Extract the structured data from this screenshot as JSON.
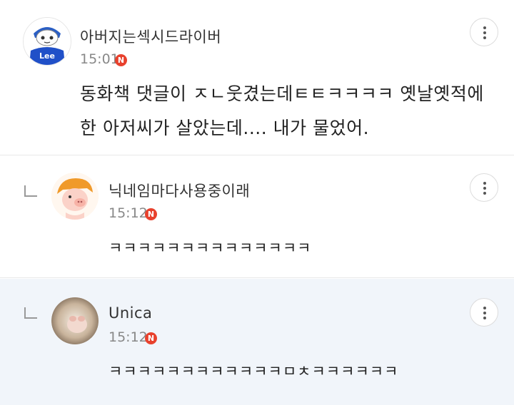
{
  "comments": [
    {
      "author": "아버지는섹시드라이버",
      "time": "15:01",
      "badge": "N",
      "text_line1": "동화책 댓글이 ㅈㄴ웃겼는데ㅌㅌㅋㅋㅋㅋ 옛날옛적에",
      "text_line2": "한 아저씨가 살았는데.... 내가 물었어.",
      "avatar_text": "Lee"
    },
    {
      "author": "닉네임마다사용중이래",
      "time": "15:12",
      "badge": "N",
      "text": "ㅋㅋㅋㅋㅋㅋㅋㅋㅋㅋㅋㅋㅋㅋ"
    },
    {
      "author": "Unica",
      "time": "15:12",
      "badge": "N",
      "text": "ㅋㅋㅋㅋㅋㅋㅋㅋㅋㅋㅋㅋㅁㅊㅋㅋㅋㅋㅋㅋ"
    }
  ],
  "icons": {
    "more": "more-vertical-icon",
    "reply": "reply-arrow-icon",
    "new": "new-badge-icon"
  },
  "colors": {
    "badge": "#e8412d",
    "reply_bg": "#f1f5fa",
    "time": "#888888"
  }
}
